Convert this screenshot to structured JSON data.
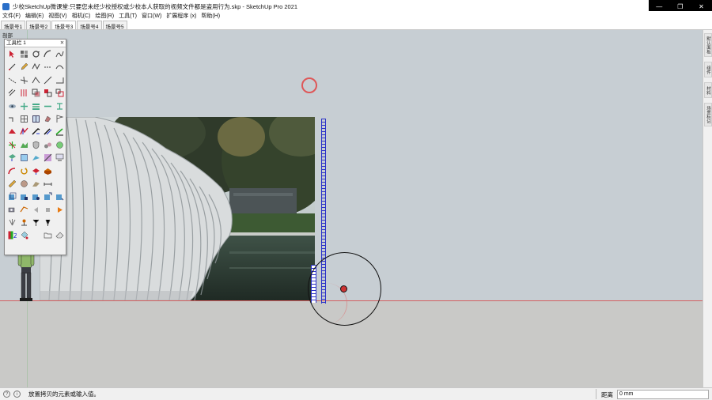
{
  "window": {
    "title": "少校SketchUp微课堂:只要您未经少校授权或少校本人获取的视频文件都是盗用行为.skp - SketchUp Pro 2021",
    "controls": {
      "minimize": "—",
      "maximize": "❐",
      "close": "✕"
    }
  },
  "menu": [
    "文件(F)",
    "编辑(E)",
    "视图(V)",
    "相机(C)",
    "绘图(R)",
    "工具(T)",
    "窗口(W)",
    "扩展程序 (x)",
    "帮助(H)"
  ],
  "scenes": [
    "场景号1",
    "场景号2",
    "场景号3",
    "场景号4",
    "场景号5"
  ],
  "active_scene_index": 2,
  "viewport": {
    "section_label": "剖部"
  },
  "toolbar": {
    "title": "工具栏 1",
    "close": "✕"
  },
  "right_tray": [
    "默认面板",
    "组件",
    "材料",
    "场景标记"
  ],
  "status": {
    "message": "放置拷贝的元素或输入值。",
    "measurement_label": "距离",
    "measurement_value": "0 mm"
  },
  "icons": [
    "info-icon",
    "help-icon",
    "select-icon",
    "tape-measure-icon",
    "figure-icon"
  ],
  "colors": {
    "viewport_sky": "#c7ced3",
    "ground": "#c9c9c7",
    "tape": "#2a31c8",
    "axis_red": "#d46060"
  }
}
